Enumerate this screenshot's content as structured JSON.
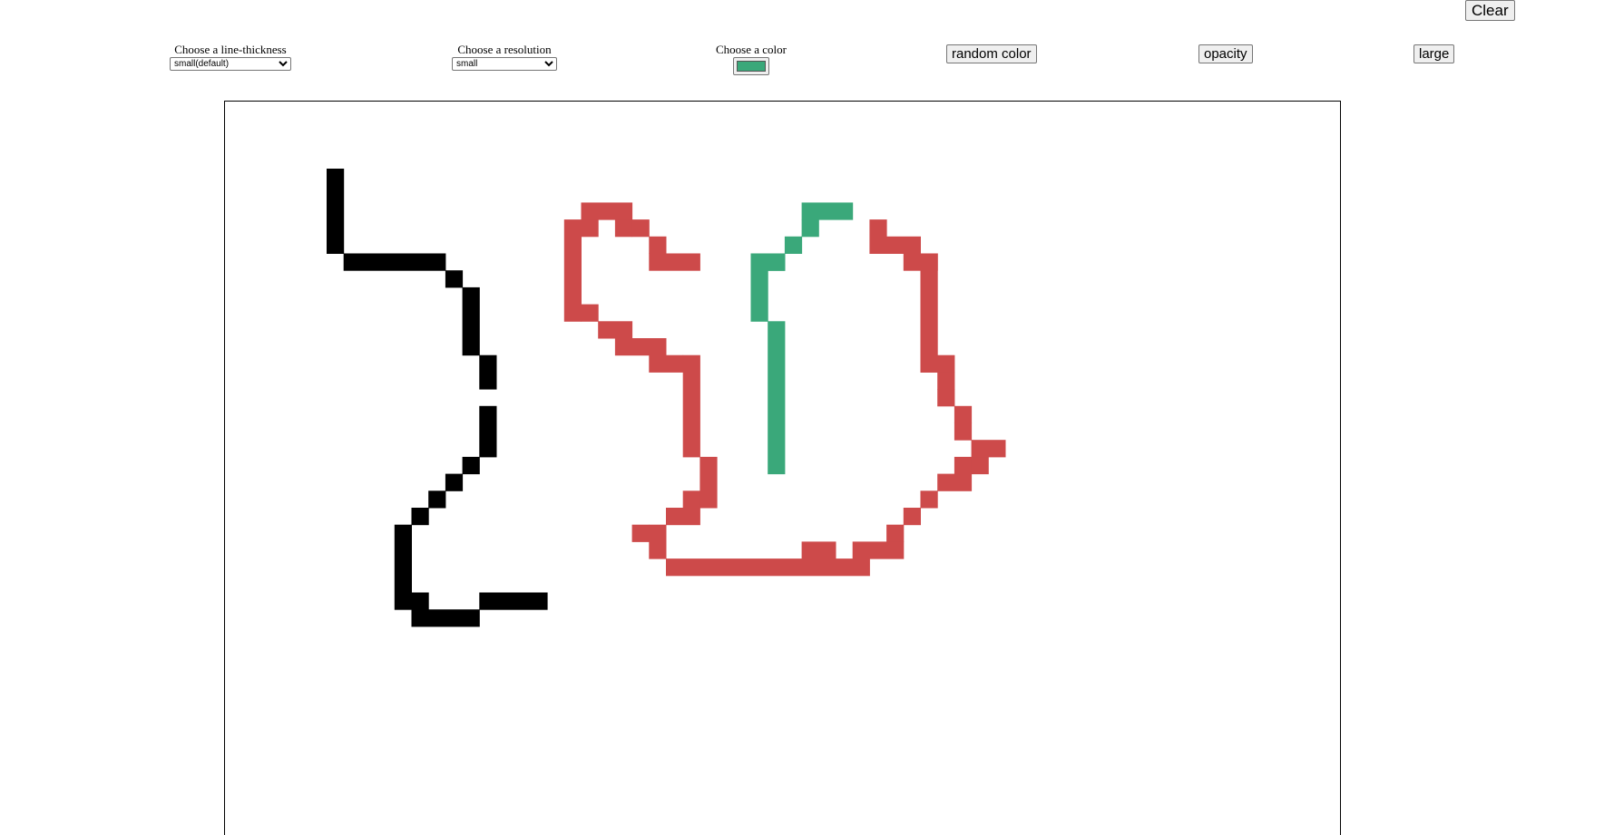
{
  "clear_button": {
    "label": "Clear"
  },
  "controls": {
    "line_thickness": {
      "label": "Choose a line-thickness",
      "selected": "small(default)"
    },
    "resolution": {
      "label": "Choose a resolution",
      "selected": "small"
    },
    "color": {
      "label": "Choose a color",
      "value": "#3aa87a"
    }
  },
  "toolbar": {
    "random_color_label": "random color",
    "opacity_label": "opacity",
    "large_label": "large"
  },
  "colors": {
    "black": "#000000",
    "red": "#cd4a4a",
    "green": "#3aa87a"
  }
}
